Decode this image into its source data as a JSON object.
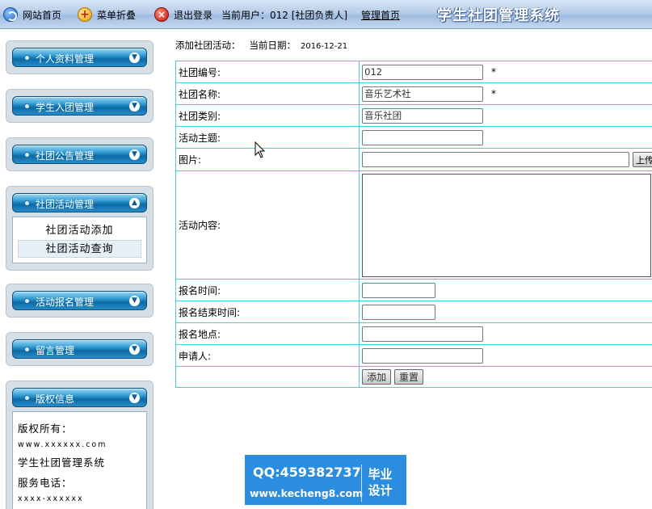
{
  "topbar": {
    "home_label": "网站首页",
    "fold_label": "菜单折叠",
    "exit_label": "退出登录",
    "current_user": "当前用户：012 [社团负责人]",
    "admin_home_label": "管理首页",
    "system_title": "学生社团管理系统"
  },
  "sidebar": {
    "menus": [
      {
        "label": "个人资料管理",
        "chevron": "down"
      },
      {
        "label": "学生入团管理",
        "chevron": "down"
      },
      {
        "label": "社团公告管理",
        "chevron": "down"
      },
      {
        "label": "社团活动管理",
        "chevron": "up",
        "items": [
          "社团活动添加",
          "社团活动查询"
        ]
      },
      {
        "label": "活动报名管理",
        "chevron": "down"
      },
      {
        "label": "留言管理",
        "chevron": "down"
      },
      {
        "label": "版权信息",
        "chevron": "down"
      }
    ],
    "copyright": {
      "line1": "版权所有：",
      "line2": "www.xxxxxx.com",
      "line3": "学生社团管理系统",
      "line4": "服务电话：",
      "line5": "xxxx-xxxxxx"
    }
  },
  "main": {
    "crumb": "添加社团活动：   当前日期：",
    "date": "2016-12-21",
    "form": {
      "club_id_label": "社团编号:",
      "club_id_value": "012",
      "club_name_label": "社团名称:",
      "club_name_value": "音乐艺术社",
      "club_type_label": "社团类别:",
      "club_type_value": "音乐社团",
      "topic_label": "活动主题:",
      "image_label": "图片:",
      "upload_label": "上传",
      "content_label": "活动内容:",
      "signup_time_label": "报名时间:",
      "signup_end_label": "报名结束时间:",
      "location_label": "报名地点:",
      "applicant_label": "申请人:",
      "required_mark": "*",
      "add_button": "添加",
      "reset_button": "重置"
    }
  },
  "watermark": {
    "qq": "QQ:459382737",
    "url": "www.kecheng8.com",
    "badge_top": "毕业",
    "badge_bottom": "设计"
  },
  "colors": {
    "form_border": "#4ec8e8",
    "menu_header": "#0b6aa6",
    "topbar": "#b7cde9",
    "watermark": "#2a8de0"
  }
}
